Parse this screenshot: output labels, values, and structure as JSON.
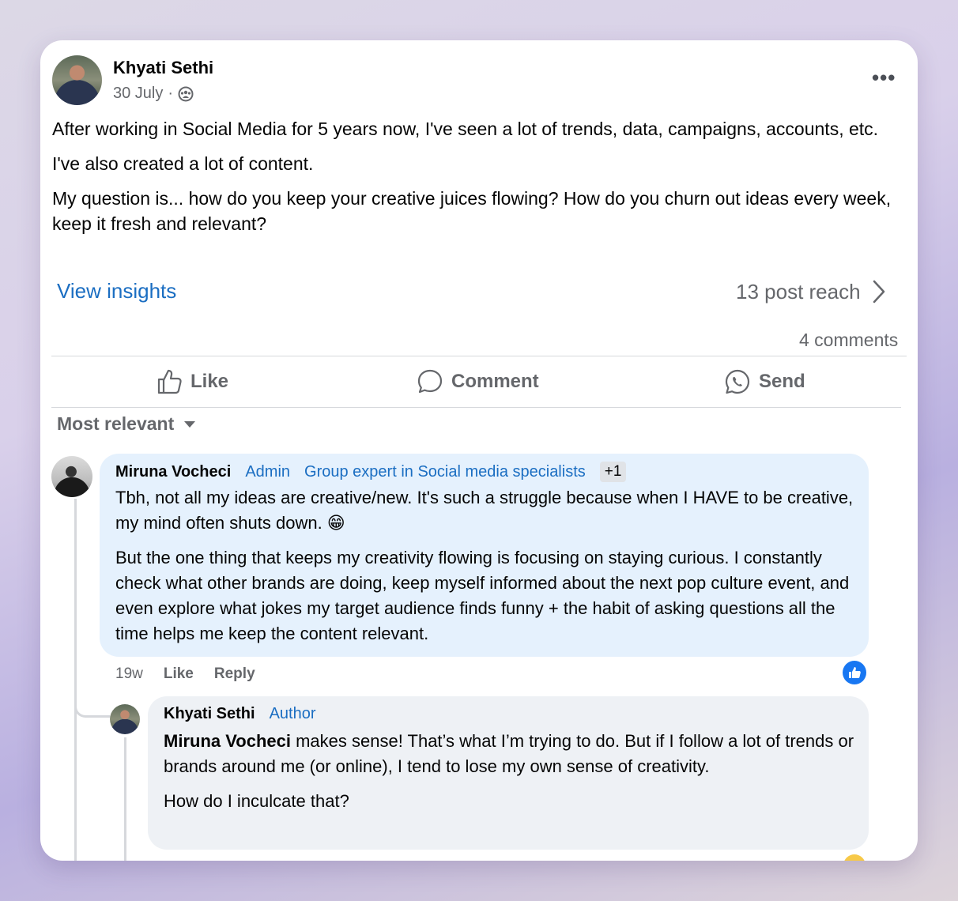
{
  "post": {
    "author": "Khyati Sethi",
    "date": "30 July",
    "separator": "·",
    "paragraphs": [
      "After working in Social Media for 5 years now, I've seen a lot of trends, data, campaigns, accounts, etc.",
      "I've also created a lot of content.",
      "My question is... how do you keep your creative juices flowing? How do you churn out ideas every week, keep it fresh and relevant?"
    ],
    "insights_label": "View insights",
    "reach_label": "13 post reach",
    "comments_count": "4 comments"
  },
  "actions": {
    "like": "Like",
    "comment": "Comment",
    "send": "Send"
  },
  "sort_label": "Most relevant",
  "comments": [
    {
      "name": "Miruna Vocheci",
      "badges": [
        "Admin",
        "Group expert in Social media specialists"
      ],
      "extra_badge": "+1",
      "paragraphs": [
        "Tbh, not all my ideas are creative/new. It's such a struggle because when I HAVE to be creative, my mind often shuts down. 😁",
        "But the one thing that keeps my creativity flowing is focusing on staying curious. I constantly check what other brands are doing, keep myself informed about the next pop culture event, and even explore what jokes my target audience finds funny + the habit of asking questions all the time helps me keep the content relevant."
      ],
      "time": "19w",
      "like": "Like",
      "reply": "Reply"
    }
  ],
  "reply": {
    "name": "Khyati Sethi",
    "badge": "Author",
    "mention": "Miruna Vocheci",
    "text": " makes sense! That’s what I’m trying to do. But if I follow a lot of trends or brands around me (or online), I tend to lose my own sense of creativity.",
    "text2": "How do I inculcate that?"
  },
  "colors": {
    "accent": "#1b6ec2",
    "admin_bubble": "#e5f1fd",
    "reply_bubble": "#eef1f5",
    "like_badge": "#1877f2"
  }
}
